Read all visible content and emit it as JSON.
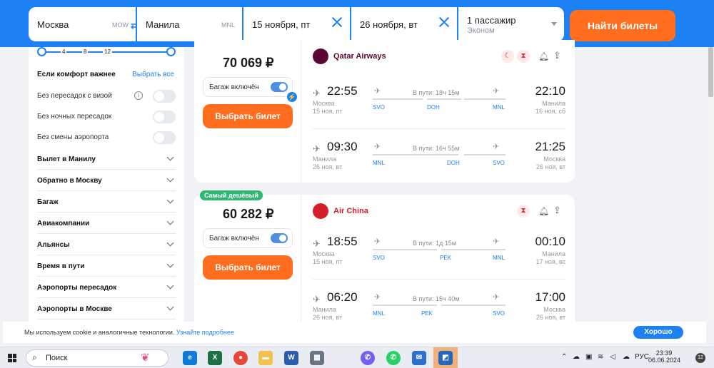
{
  "search": {
    "from_city": "Москва",
    "from_code": "MOW",
    "swap_icon": "⇄",
    "to_city": "Манила",
    "to_code": "MNL",
    "depart_date": "15 ноября, пт",
    "return_date": "26 ноября, вт",
    "passengers": "1 пассажир",
    "cabin": "Эконом",
    "find_button": "Найти билеты"
  },
  "filters": {
    "transfer_slider": {
      "ticks": [
        "4",
        "8",
        "12"
      ]
    },
    "comfort_heading": "Если комфорт важнее",
    "select_all": "Выбрать все",
    "toggles": [
      {
        "label": "Без пересадок с визой",
        "on": false
      },
      {
        "label": "Без ночных пересадок",
        "on": false
      },
      {
        "label": "Без смены аэропорта",
        "on": false
      }
    ],
    "sections": [
      "Вылет в Манилу",
      "Обратно в Москву",
      "Багаж",
      "Авиакомпании",
      "Альянсы",
      "Время в пути",
      "Аэропорты пересадок",
      "Аэропорты в Москве"
    ]
  },
  "results": [
    {
      "badge": "",
      "price": "70 069 ₽",
      "baggage_label": "Багаж включён",
      "choose_label": "Выбрать билет",
      "airline": "Qatar Airways",
      "airline_color": "#5c0632",
      "segments": [
        {
          "dep_time": "22:55",
          "dep_city": "Москва",
          "dep_date": "15 ноя, пт",
          "duration": "В пути: 18ч 15м",
          "arr_time": "22:10",
          "arr_city": "Манила",
          "arr_date": "16 ноя, сб",
          "airports": [
            "SVO",
            "DOH",
            "MNL"
          ]
        },
        {
          "dep_time": "09:30",
          "dep_city": "Манила",
          "dep_date": "26 ноя, вт",
          "duration": "В пути: 16ч 55м",
          "arr_time": "21:25",
          "arr_city": "Москва",
          "arr_date": "26 ноя, вт",
          "airports": [
            "MNL",
            "DOH",
            "SVO"
          ]
        }
      ]
    },
    {
      "badge": "Самый дешёвый",
      "price": "60 282 ₽",
      "baggage_label": "Багаж включён",
      "choose_label": "Выбрать билет",
      "airline": "Air China",
      "airline_color": "#d31f2b",
      "segments": [
        {
          "dep_time": "18:55",
          "dep_city": "Москва",
          "dep_date": "15 ноя, пт",
          "duration": "В пути: 1д 15м",
          "arr_time": "00:10",
          "arr_city": "Манила",
          "arr_date": "17 ноя, вс",
          "airports": [
            "SVO",
            "PEK",
            "MNL"
          ]
        },
        {
          "dep_time": "06:20",
          "dep_city": "Манила",
          "dep_date": "26 ноя, вт",
          "duration": "В пути: 15ч 40м",
          "arr_time": "17:00",
          "arr_city": "Москва",
          "arr_date": "26 ноя, вт",
          "airports": [
            "MNL",
            "PEK",
            "SVO"
          ]
        }
      ]
    }
  ],
  "cookie": {
    "text": "Мы используем cookie и аналогичные технологии.",
    "link": "Узнайте подробнее",
    "ok": "Хорошо"
  },
  "taskbar": {
    "search_placeholder": "Поиск",
    "lang": "РУС",
    "time": "23:39",
    "date": "06.06.2024",
    "notifications": "12",
    "apps": [
      "edge-icon",
      "excel-icon",
      "chrome-icon",
      "file-explorer-icon",
      "word-icon",
      "calculator-icon",
      "viber-icon",
      "whatsapp-icon",
      "mail-icon",
      "app-icon"
    ]
  }
}
